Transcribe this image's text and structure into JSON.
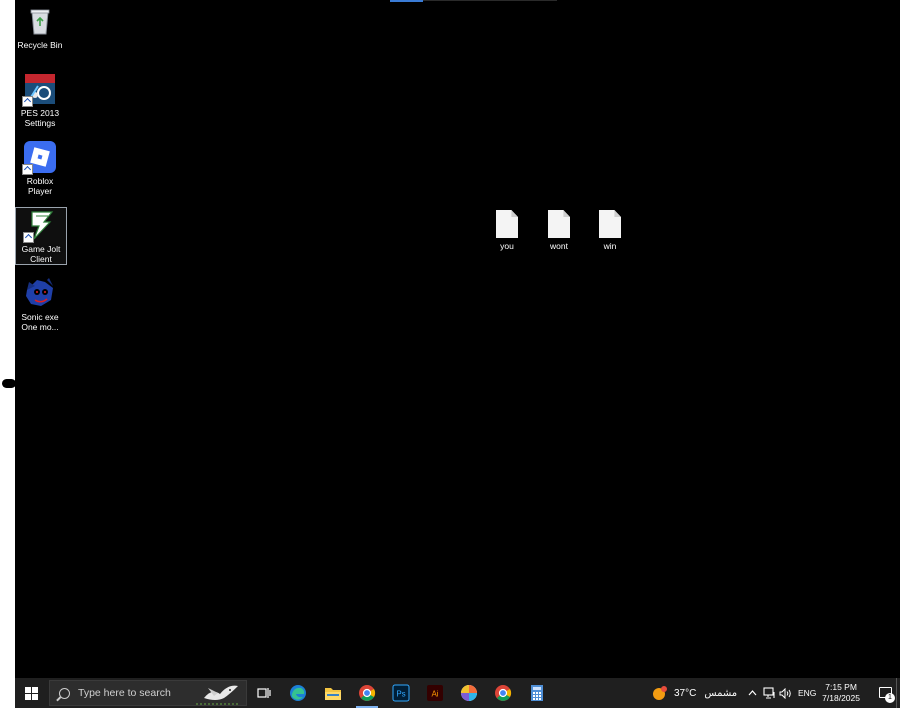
{
  "desktop": {
    "icons": [
      {
        "label": "Recycle Bin"
      },
      {
        "label": "PES 2013 Settings"
      },
      {
        "label": "Roblox Player"
      },
      {
        "label": "Game Jolt Client"
      },
      {
        "label": "Sonic exe One mo..."
      }
    ],
    "files": [
      {
        "label": "you"
      },
      {
        "label": "wont"
      },
      {
        "label": "win"
      }
    ]
  },
  "taskbar": {
    "search_placeholder": "Type here to search",
    "pinned": [
      "task-view",
      "edge",
      "file-explorer",
      "chrome",
      "photoshop",
      "illustrator",
      "photos",
      "chrome-alt",
      "calculator"
    ],
    "weather_temp": "37°C",
    "weather_desc": "مشمس",
    "language": "ENG",
    "time": "7:15 PM",
    "date": "7/18/2025",
    "notification_count": "1"
  },
  "colors": {
    "desktop_bg": "#000000",
    "taskbar_bg": "#1f1f1f",
    "accent": "#7fb2f0"
  }
}
